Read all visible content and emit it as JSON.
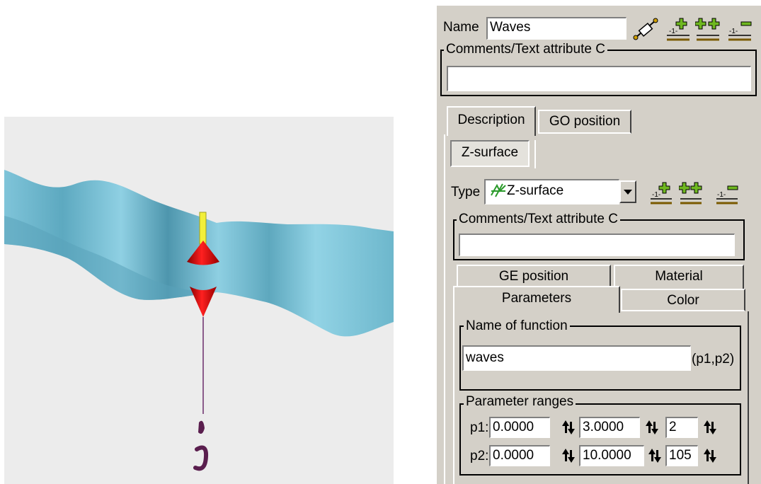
{
  "object": {
    "name_label": "Name",
    "name_value": "Waves",
    "comments_label": "Comments/Text attribute C",
    "comments_value": ""
  },
  "tabs_top": [
    {
      "label": "Description",
      "active": true
    },
    {
      "label": "GO position",
      "active": false
    }
  ],
  "subtype_tab": "Z-surface",
  "type_row": {
    "label": "Type",
    "value": "Z-surface",
    "comments_label": "Comments/Text attribute C",
    "comments_value": ""
  },
  "tabs_inner_back": [
    "GE position",
    "Material"
  ],
  "tabs_inner_front": [
    {
      "label": "Parameters",
      "active": true
    },
    {
      "label": "Color",
      "active": false
    }
  ],
  "function_group": {
    "title": "Name of function",
    "value": "waves",
    "suffix": "(p1,p2)"
  },
  "ranges_group": {
    "title": "Parameter ranges",
    "rows": [
      {
        "label": "p1:",
        "from": "0.0000",
        "to": "3.0000",
        "steps": "2"
      },
      {
        "label": "p2:",
        "from": "0.0000",
        "to": "10.0000",
        "steps": "105"
      }
    ]
  },
  "icons": [
    "link-icon",
    "add-after-icon",
    "add-before-icon",
    "remove-icon",
    "spin-arrows-icon",
    "z-surface-icon",
    "dropdown-arrow-icon"
  ],
  "colors": {
    "panel_bg": "#d4d0c8",
    "surface": "#8ecfe2",
    "float_red": "#e01010",
    "float_tip": "#f2ef3a",
    "line": "#6b2d6b",
    "hook": "#5a1e4e"
  }
}
